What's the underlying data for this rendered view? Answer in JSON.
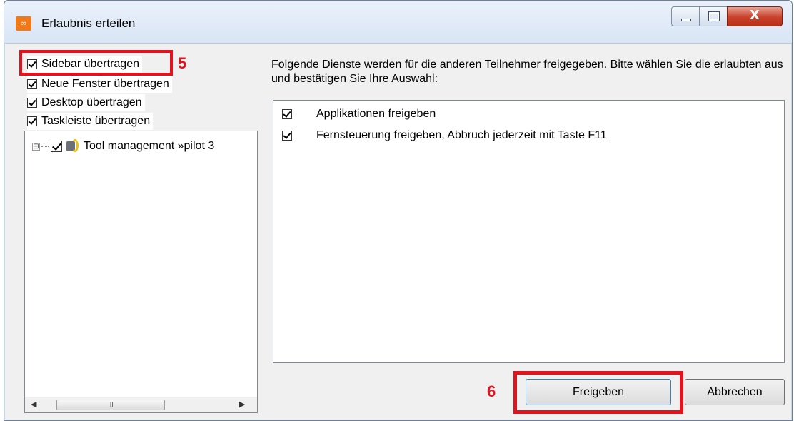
{
  "window": {
    "title": "Erlaubnis erteilen",
    "app_icon": "app-logo-icon",
    "controls": {
      "minimize": "minimize-icon",
      "maximize": "maximize-icon",
      "close_glyph": "X"
    }
  },
  "left": {
    "options": [
      {
        "label": "Sidebar übertragen",
        "checked": true
      },
      {
        "label": "Neue Fenster übertragen",
        "checked": true
      },
      {
        "label": "Desktop übertragen",
        "checked": true
      },
      {
        "label": "Taskleiste übertragen",
        "checked": true
      }
    ],
    "tree": {
      "expander": "⊞",
      "item_label": "Tool management »pilot 3",
      "item_checked": true,
      "scroll_thumb_glyph": "III"
    }
  },
  "right": {
    "description": "Folgende Dienste werden für die anderen Teilnehmer freigegeben. Bitte wählen Sie die erlaubten aus und bestätigen Sie Ihre Auswahl:",
    "services": [
      {
        "label": "Applikationen freigeben",
        "checked": true
      },
      {
        "label": "Fernsteuerung freigeben, Abbruch jederzeit mit Taste F11",
        "checked": true
      }
    ]
  },
  "buttons": {
    "ok": "Freigeben",
    "cancel": "Abbrechen"
  },
  "annotations": {
    "marker_5": "5",
    "marker_6": "6",
    "color": "#e0141e"
  }
}
